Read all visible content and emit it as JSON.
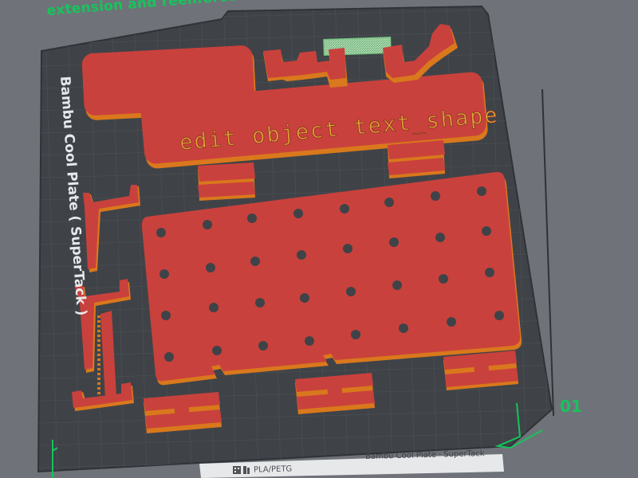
{
  "viewport": {
    "banner_text": "extension and reenforcements to fit both",
    "plate_name": "Bambu Cool Plate ( SuperTack )",
    "plate_number": "01",
    "filament_label": "PLA/PETG",
    "plate_label_small": "Bambu Cool Plate · SuperTack",
    "embossed_text": "edit object text_shape"
  },
  "colors": {
    "background": "#6f7379",
    "plate": "#3f4348",
    "part_top": "#c9413c",
    "part_side": "#d9781c",
    "accent": "#16c45b"
  }
}
